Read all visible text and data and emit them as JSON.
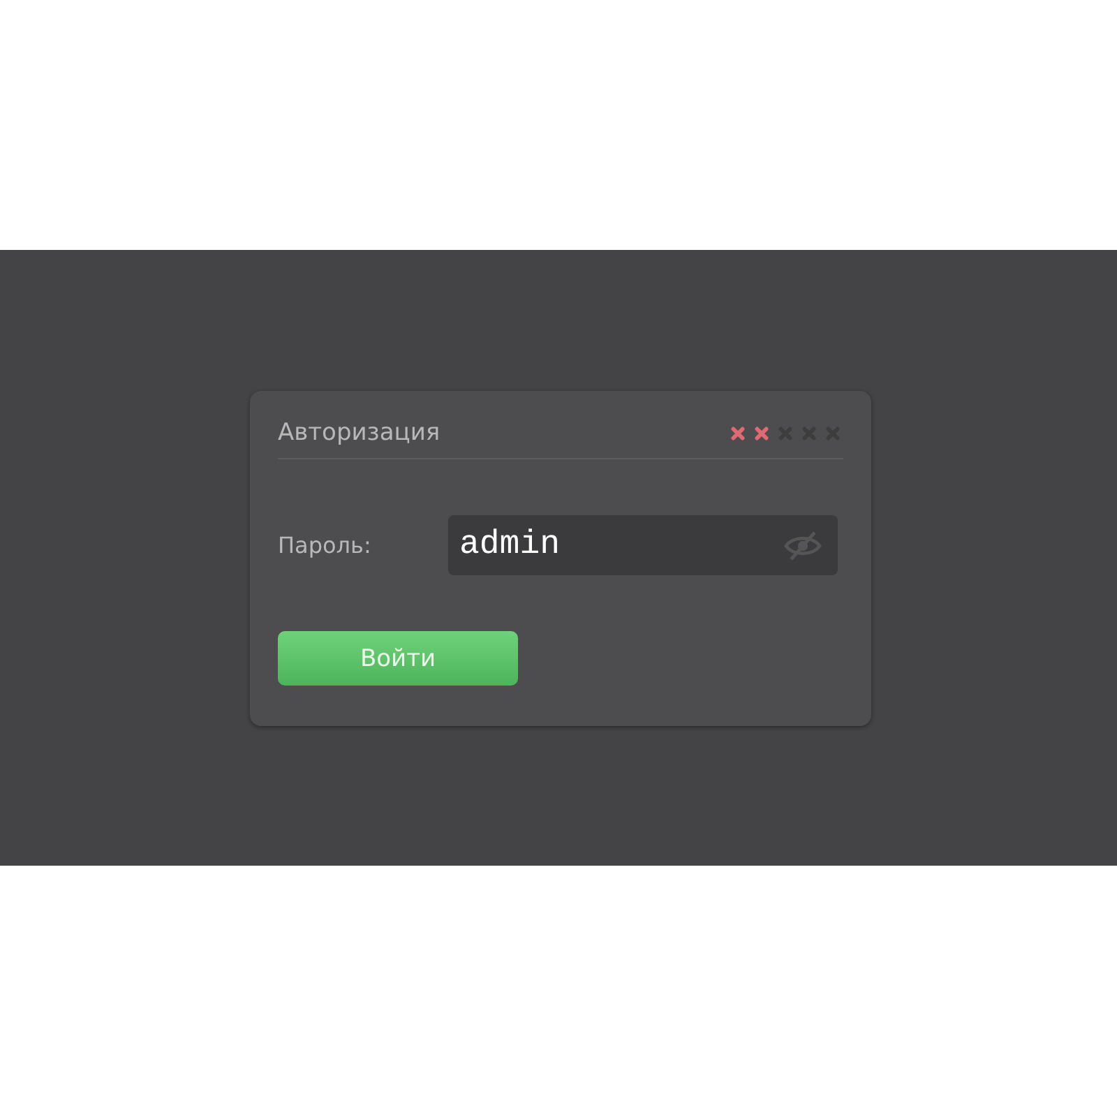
{
  "dialog": {
    "title": "Авторизация",
    "attempts": [
      {
        "failed": true
      },
      {
        "failed": true
      },
      {
        "failed": false
      },
      {
        "failed": false
      },
      {
        "failed": false
      }
    ],
    "password": {
      "label": "Пароль:",
      "value": "admin",
      "visible": true
    },
    "button": "Войти"
  }
}
